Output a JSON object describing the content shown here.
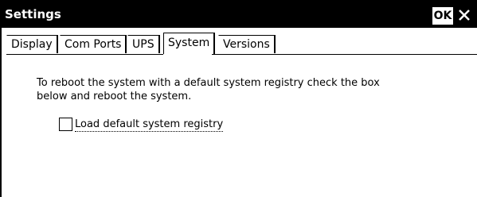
{
  "window": {
    "title": "Settings",
    "ok_label": "OK",
    "close_icon": "close-icon"
  },
  "tabs": [
    {
      "label": "Display",
      "active": false
    },
    {
      "label": "Com Ports",
      "active": false
    },
    {
      "label": "UPS",
      "active": false
    },
    {
      "label": "System",
      "active": true
    },
    {
      "label": "Versions",
      "active": false
    }
  ],
  "system": {
    "description_line1": "To reboot the system with a default system registry check the box",
    "description_line2": "below and reboot the system.",
    "checkbox_label": "Load default system registry",
    "checkbox_checked": false
  }
}
